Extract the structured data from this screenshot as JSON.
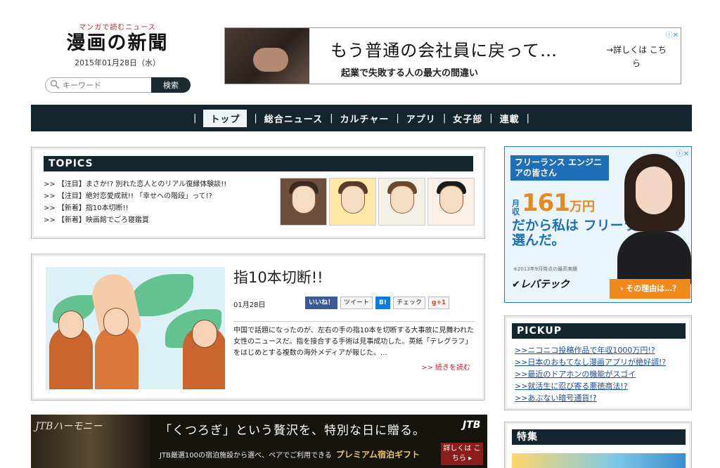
{
  "header": {
    "tagline": "マンガで読むニュース",
    "logo": "漫画の新聞",
    "date": "2015年01月28日（水）"
  },
  "search": {
    "placeholder": "キーワード",
    "button": "検索"
  },
  "top_ad": {
    "headline": "もう普通の会社員に戻って…",
    "sub": "起業で失敗する人の最大の間違い",
    "more": "→詳しくは こちら"
  },
  "nav": [
    "トップ",
    "総合ニュース",
    "カルチャー",
    "アプリ",
    "女子部",
    "連載"
  ],
  "topics": {
    "title": "TOPICS",
    "items": [
      ">> 【注目】まさか!? 別れた恋人とのリアル復縁体験談!!",
      ">> 【注目】絶対恋愛成就!! 「幸せへの階段」って!?",
      ">> 【新着】指10本切断!!",
      ">> 【新着】映画館でごろ寝鑑賞"
    ]
  },
  "article": {
    "title": "指10本切断!!",
    "date": "01月28日",
    "share": {
      "like": "いいね！",
      "tweet": "ツイート",
      "hatena": "B!",
      "check": "チェック",
      "gplus": "g+1"
    },
    "summary": "中国で話題になったのが、左右の手の指10本を切断する大事故に見舞われた女性のニュースだ。指を接合する手術は見事成功した。英紙「テレグラフ」をはじめとする複数の海外メディアが報じた。...",
    "readmore": ">> 続きを読む"
  },
  "bottom_ad": {
    "brand": "JTBハーモニー",
    "copy": "「くつろぎ」という贅沢を、特別な日に贈る。",
    "copy2": "JTB厳選100の宿泊施設から選べ、ペアでご利用できる",
    "gift": "プレミアム宿泊ギフト",
    "logo": "JTB",
    "cta": "詳しくは こちら ▸"
  },
  "side_ad": {
    "head": "フリーランス エンジニアの皆さん",
    "money_mark": "月収",
    "money_num": "161",
    "money_unit": "万円",
    "msg": "だから私は フリーランス を選んだ。",
    "note": "※2013年9月時点の最高実績",
    "brand": "✔レバテック",
    "cta": "› その理由は…？"
  },
  "pickup": {
    "title": "PICKUP",
    "items": [
      ">>ニコニコ投稿作品で年収1000万円!?",
      ">>日本のおもてなし漫画アプリが絶好調!?",
      ">>最近のドアホンの機能がスゴイ",
      ">>就活生に忍び寄る悪徳商法!?",
      ">>あぶない暗号通貨!?"
    ]
  },
  "tokushu": {
    "title": "特集"
  },
  "colors": {
    "nav_bg": "#13252f",
    "accent_red": "#c0262d",
    "link_blue": "#1a4c9c"
  }
}
